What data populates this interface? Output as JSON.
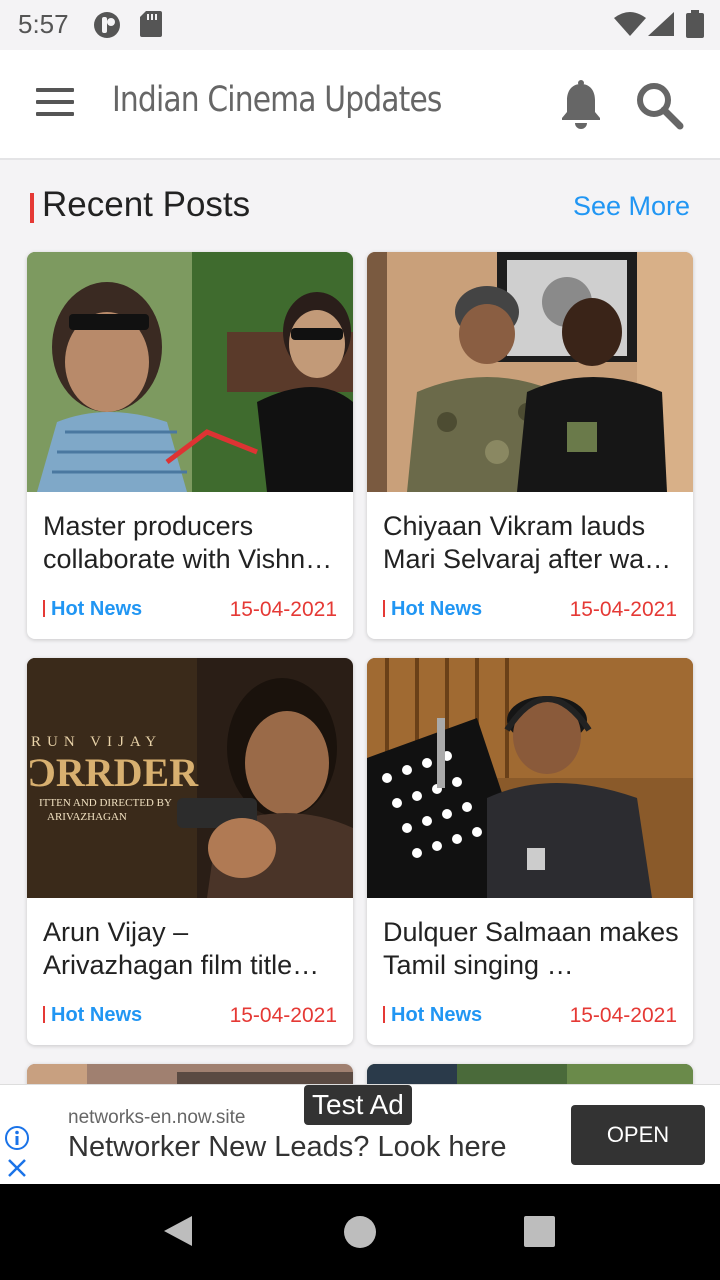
{
  "status_bar": {
    "time": "5:57"
  },
  "app_bar": {
    "title": "Indian Cinema Updates",
    "icons": [
      "menu-icon",
      "bell-icon",
      "search-icon"
    ]
  },
  "section": {
    "title": "Recent Posts",
    "see_more": "See More",
    "accent_color": "#e53935",
    "link_color": "#2196f3"
  },
  "posts": [
    {
      "title": "Master producers collaborate with Vishnu Vardhan",
      "title_display": "Master producers collaborate with Vishn…",
      "category": "Hot News",
      "date": "15-04-2021"
    },
    {
      "title": "Chiyaan Vikram lauds Mari Selvaraj after watching",
      "title_display": "Chiyaan Vikram lauds Mari Selvaraj after wa…",
      "category": "Hot News",
      "date": "15-04-2021"
    },
    {
      "title": "Arun Vijay – Arivazhagan film title",
      "title_display": "Arun Vijay – Arivazhagan film title…",
      "category": "Hot News",
      "date": "15-04-2021"
    },
    {
      "title": "Dulquer Salmaan makes Tamil singing",
      "title_display": "Dulquer Salmaan makes Tamil singing …",
      "category": "Hot News",
      "date": "15-04-2021"
    }
  ],
  "poster_text": {
    "line1": "RUN VIJAY",
    "line2": "ƆRRDER",
    "line3": "ITTEN AND DIRECTED BY",
    "line4": "ARIVAZHAGAN"
  },
  "ad": {
    "badge": "Test Ad",
    "domain": "networks-en.now.site",
    "headline": "Networker New Leads? Look here",
    "cta": "OPEN"
  }
}
